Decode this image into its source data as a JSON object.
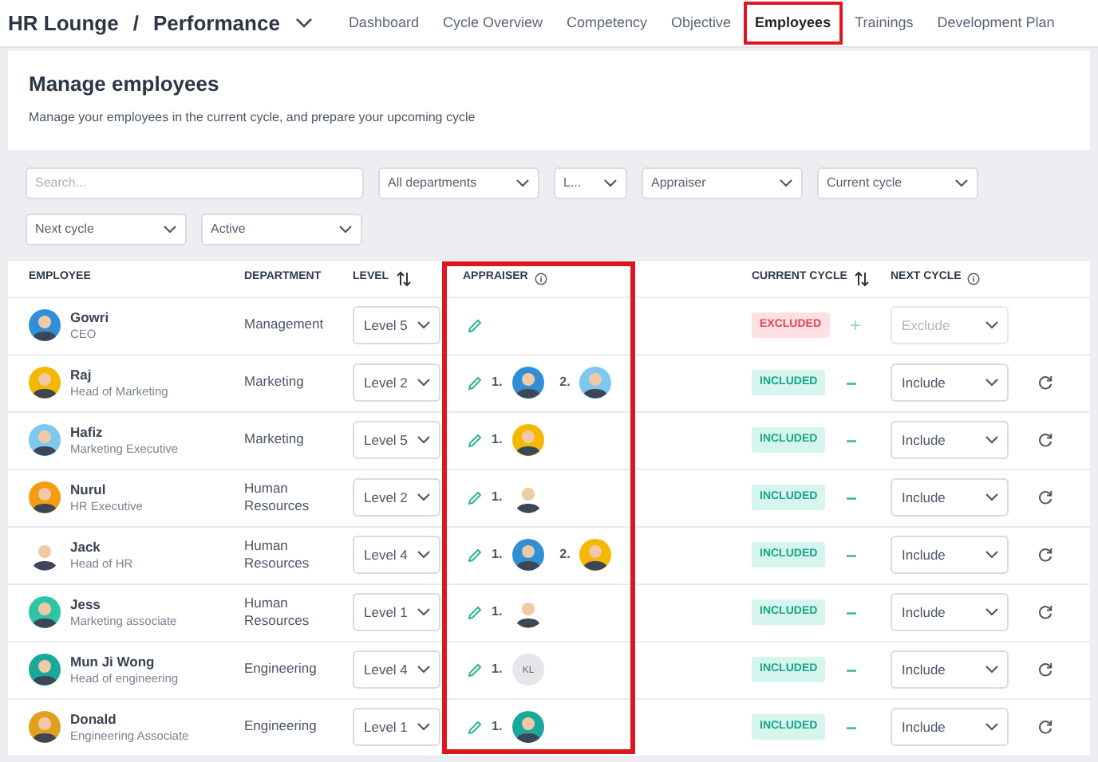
{
  "app": {
    "brand": "HR Lounge",
    "separator": "/",
    "module": "Performance"
  },
  "nav": [
    {
      "label": "Dashboard",
      "selected": false,
      "highlighted": false
    },
    {
      "label": "Cycle Overview",
      "selected": false,
      "highlighted": false
    },
    {
      "label": "Competency",
      "selected": false,
      "highlighted": false
    },
    {
      "label": "Objective",
      "selected": false,
      "highlighted": false
    },
    {
      "label": "Employees",
      "selected": true,
      "highlighted": true
    },
    {
      "label": "Trainings",
      "selected": false,
      "highlighted": false
    },
    {
      "label": "Development Plan",
      "selected": false,
      "highlighted": false
    }
  ],
  "header": {
    "title": "Manage employees",
    "subtitle": "Manage your employees in the current cycle, and prepare your upcoming cycle"
  },
  "filters": {
    "search": {
      "placeholder": "Search..."
    },
    "selects": [
      {
        "value": "All departments"
      },
      {
        "value": "L..."
      },
      {
        "value": "Appraiser"
      },
      {
        "value": "Current cycle"
      },
      {
        "value": "Next cycle"
      },
      {
        "value": "Active"
      }
    ]
  },
  "table": {
    "columns": [
      {
        "label": "EMPLOYEE",
        "kind": "plain"
      },
      {
        "label": "DEPARTMENT",
        "kind": "plain"
      },
      {
        "label": "LEVEL",
        "kind": "sortable"
      },
      {
        "label": "APPRAISER",
        "kind": "info",
        "highlighted": true
      },
      {
        "label": "CURRENT CYCLE",
        "kind": "sortable"
      },
      {
        "label": "NEXT CYCLE",
        "kind": "info"
      }
    ],
    "rows": [
      {
        "name": "Gowri",
        "role": "CEO",
        "avatar": {
          "color": "#2f8fd8"
        },
        "department": "Management",
        "level": "Level 5",
        "appraisers": [],
        "current_cycle": {
          "label": "EXCLUDED",
          "kind": "excluded"
        },
        "toggle": "+",
        "next_cycle": {
          "value": "Exclude",
          "disabled": true
        },
        "resettable": false
      },
      {
        "name": "Raj",
        "role": "Head of Marketing",
        "avatar": {
          "color": "#f5b800"
        },
        "department": "Marketing",
        "level": "Level 2",
        "appraisers": [
          {
            "number": "1.",
            "avatar": {
              "color": "#2f8fd8"
            }
          },
          {
            "number": "2.",
            "avatar": {
              "color": "#7cc8ef"
            }
          }
        ],
        "current_cycle": {
          "label": "INCLUDED",
          "kind": "included"
        },
        "toggle": "–",
        "next_cycle": {
          "value": "Include",
          "disabled": false
        },
        "resettable": true
      },
      {
        "name": "Hafiz",
        "role": "Marketing Executive",
        "avatar": {
          "color": "#7cc8ef"
        },
        "department": "Marketing",
        "level": "Level 5",
        "appraisers": [
          {
            "number": "1.",
            "avatar": {
              "color": "#f5b800"
            }
          }
        ],
        "current_cycle": {
          "label": "INCLUDED",
          "kind": "included"
        },
        "toggle": "–",
        "next_cycle": {
          "value": "Include",
          "disabled": false
        },
        "resettable": true
      },
      {
        "name": "Nurul",
        "role": "HR Executive",
        "avatar": {
          "color": "#f39c12"
        },
        "department": "Human Resources",
        "level": "Level 2",
        "appraisers": [
          {
            "number": "1.",
            "avatar": {
              "color": "#ffffff"
            }
          }
        ],
        "current_cycle": {
          "label": "INCLUDED",
          "kind": "included"
        },
        "toggle": "–",
        "next_cycle": {
          "value": "Include",
          "disabled": false
        },
        "resettable": true
      },
      {
        "name": "Jack",
        "role": "Head of HR",
        "avatar": {
          "color": "#ffffff"
        },
        "department": "Human Resources",
        "level": "Level 4",
        "appraisers": [
          {
            "number": "1.",
            "avatar": {
              "color": "#2f8fd8"
            }
          },
          {
            "number": "2.",
            "avatar": {
              "color": "#f5b800"
            }
          }
        ],
        "current_cycle": {
          "label": "INCLUDED",
          "kind": "included"
        },
        "toggle": "–",
        "next_cycle": {
          "value": "Include",
          "disabled": false
        },
        "resettable": true
      },
      {
        "name": "Jess",
        "role": "Marketing associate",
        "avatar": {
          "color": "#2ec4a6"
        },
        "department": "Human Resources",
        "level": "Level 1",
        "appraisers": [
          {
            "number": "1.",
            "avatar": {
              "color": "#ffffff"
            }
          }
        ],
        "current_cycle": {
          "label": "INCLUDED",
          "kind": "included"
        },
        "toggle": "–",
        "next_cycle": {
          "value": "Include",
          "disabled": false
        },
        "resettable": true
      },
      {
        "name": "Mun Ji Wong",
        "role": "Head of engineering",
        "avatar": {
          "color": "#1aa89a"
        },
        "department": "Engineering",
        "level": "Level 4",
        "appraisers": [
          {
            "number": "1.",
            "avatar": {
              "color": "#e4e6ea",
              "initials": "KL"
            }
          }
        ],
        "current_cycle": {
          "label": "INCLUDED",
          "kind": "included"
        },
        "toggle": "–",
        "next_cycle": {
          "value": "Include",
          "disabled": false
        },
        "resettable": true
      },
      {
        "name": "Donald",
        "role": "Engineering Associate",
        "avatar": {
          "color": "#e0a020"
        },
        "department": "Engineering",
        "level": "Level 1",
        "appraisers": [
          {
            "number": "1.",
            "avatar": {
              "color": "#1aa89a"
            }
          }
        ],
        "current_cycle": {
          "label": "INCLUDED",
          "kind": "included"
        },
        "toggle": "–",
        "next_cycle": {
          "value": "Include",
          "disabled": false
        },
        "resettable": true
      }
    ]
  }
}
